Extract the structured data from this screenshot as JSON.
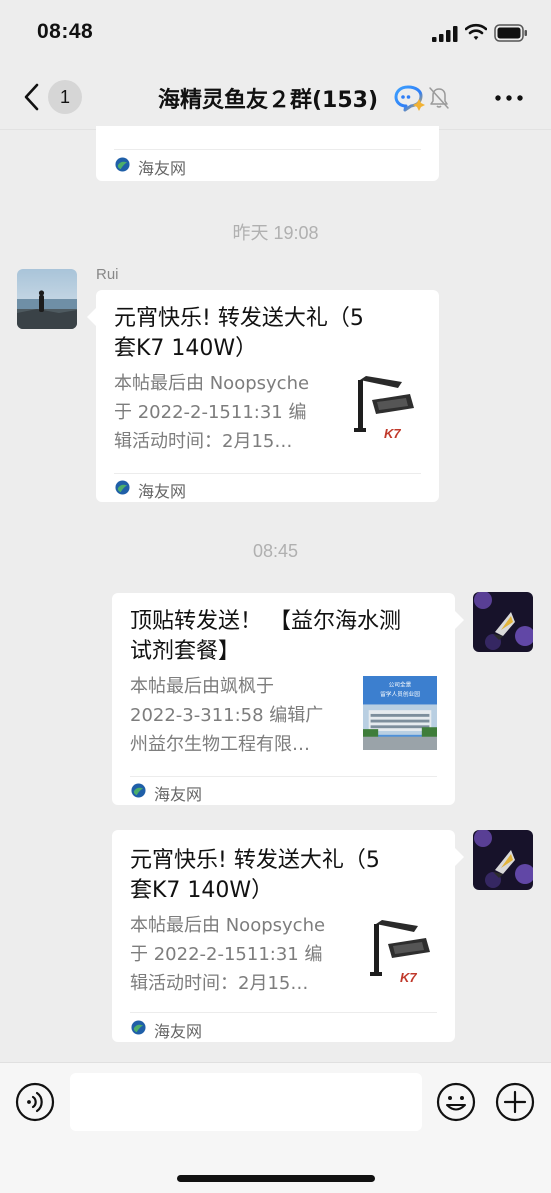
{
  "status_bar": {
    "time": "08:48",
    "icons": [
      "signal-icon",
      "wifi-icon",
      "battery-icon"
    ]
  },
  "nav": {
    "back_icon": "chevron-left-icon",
    "unread_count": "1",
    "title": "海精灵鱼友２群(153)",
    "icons": [
      "ai-assistant-icon",
      "bell-mute-icon",
      "more-icon"
    ]
  },
  "messages": [
    {
      "type": "link-card-partial",
      "direction": "incoming",
      "source": "海友网"
    },
    {
      "type": "timestamp",
      "text": "昨天 19:08"
    },
    {
      "type": "link-card",
      "direction": "incoming",
      "sender": "Rui",
      "title_lines": [
        "元宵快乐! 转发送大礼（5",
        "套K7  140W）"
      ],
      "desc_lines": [
        "本帖最后由 Noopsyche",
        "于 2022-2-1511:31 编",
        "辑活动时间：2月15…"
      ],
      "thumbnail": "aquarium-lamp",
      "thumbnail_brand": "K7",
      "source": "海友网"
    },
    {
      "type": "timestamp",
      "text": "08:45"
    },
    {
      "type": "link-card",
      "direction": "outgoing",
      "title_lines": [
        "顶贴转发送！ 【益尔海水测",
        "试剂套餐】"
      ],
      "desc_lines": [
        "本帖最后由飒枫于",
        "2022-3-311:58 编辑广",
        "州益尔生物工程有限…"
      ],
      "thumbnail": "office-building",
      "thumbnail_caption": [
        "公司全景",
        "留学人员创业园"
      ],
      "source": "海友网"
    },
    {
      "type": "link-card",
      "direction": "outgoing",
      "title_lines": [
        "元宵快乐! 转发送大礼（5",
        "套K7  140W）"
      ],
      "desc_lines": [
        "本帖最后由 Noopsyche",
        "于 2022-2-1511:31 编",
        "辑活动时间：2月15…"
      ],
      "thumbnail": "aquarium-lamp",
      "thumbnail_brand": "K7",
      "source": "海友网"
    }
  ],
  "input_bar": {
    "value": "",
    "icons": [
      "voice-icon",
      "emoji-icon",
      "plus-icon"
    ]
  },
  "colors": {
    "background": "#ededed",
    "bubble": "#ffffff",
    "timestamp": "#b0b0b0",
    "source_icon_green": "#2e7d4f",
    "source_icon_blue": "#1f5fa8"
  }
}
